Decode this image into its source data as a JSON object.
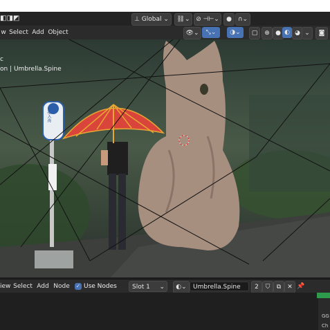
{
  "transform": {
    "orientation": "Global"
  },
  "header": {
    "menus": [
      "w",
      "Select",
      "Add",
      "Object"
    ]
  },
  "viewport": {
    "overlay_line1": "c",
    "overlay_line2": "on | Umbrella.Spine",
    "sign_text": "七福入舟"
  },
  "node_header": {
    "menus": [
      "iew",
      "Select",
      "Add",
      "Node"
    ],
    "use_nodes_label": "Use Nodes",
    "use_nodes_checked": true,
    "slot_label": "Slot 1",
    "material_name": "Umbrella.Spine",
    "user_count": "2"
  },
  "side_panel": {
    "tab_label": "Ch",
    "item1": "GG",
    "item2": "Ch"
  },
  "colors": {
    "accent": "#4772b3",
    "header_bg": "#2b2b2b",
    "umbrella": "#d9453a",
    "node_panel_tab": "#2e9b4c"
  }
}
